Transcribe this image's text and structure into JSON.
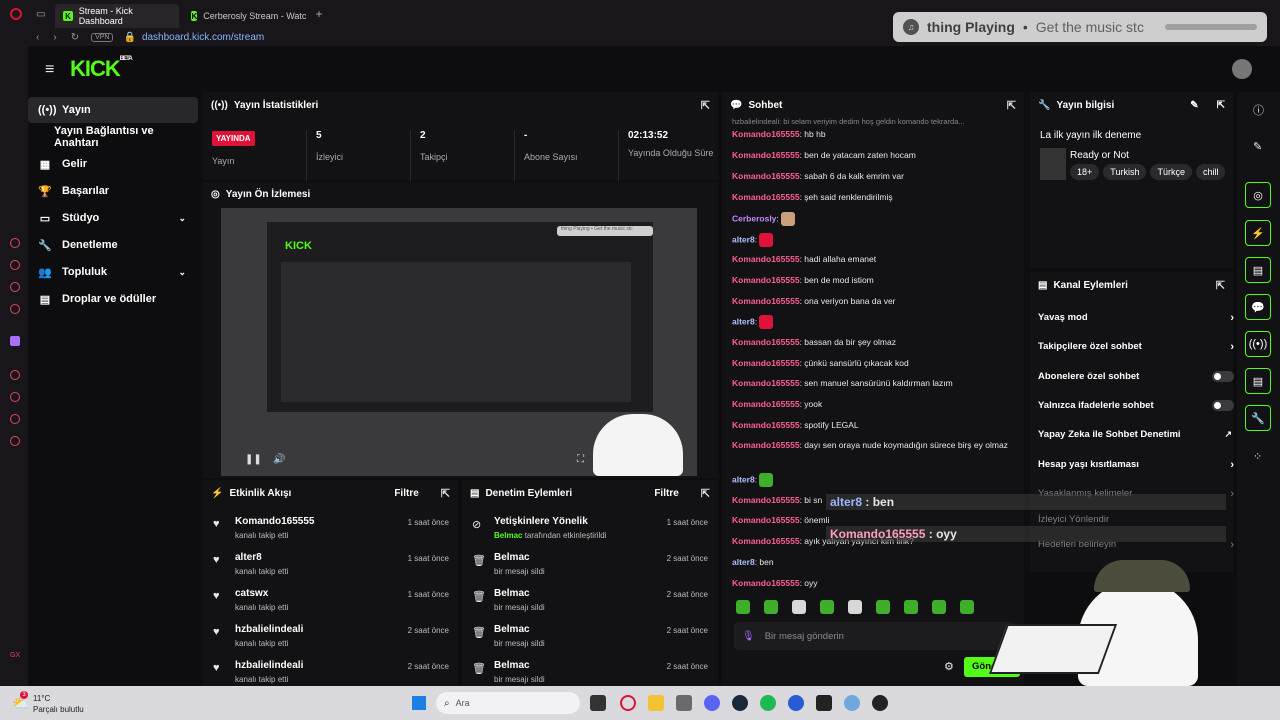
{
  "browser": {
    "tabs": [
      {
        "label": "Stream - Kick Dashboard"
      },
      {
        "label": "Cerberosly Stream - Watc"
      }
    ],
    "vpn": "VPN",
    "url": "dashboard.kick.com/stream"
  },
  "media": {
    "title": "thing Playing",
    "sep": "•",
    "subtitle": "Get the music stc"
  },
  "brand": {
    "logo": "KICK",
    "beta": "BETA"
  },
  "sidebar": {
    "items": [
      {
        "label": "Yayın",
        "icon": "broadcast-icon"
      },
      {
        "label": "Yayın Bağlantısı ve Anahtarı"
      },
      {
        "label": "Gelir",
        "icon": "revenue-icon"
      },
      {
        "label": "Başarılar",
        "icon": "trophy-icon"
      },
      {
        "label": "Stüdyo",
        "icon": "studio-icon"
      },
      {
        "label": "Denetleme",
        "icon": "wrench-icon"
      },
      {
        "label": "Topluluk",
        "icon": "community-icon"
      },
      {
        "label": "Droplar ve ödüller",
        "icon": "drops-icon"
      }
    ]
  },
  "stats": {
    "title": "Yayın İstatistikleri",
    "live_badge": "YAYINDA",
    "live_label": "Yayın",
    "viewers_value": "5",
    "viewers_label": "İzleyici",
    "followers_value": "2",
    "followers_label": "Takipçi",
    "subs_value": "-",
    "subs_label": "Abone Sayısı",
    "uptime_value": "02:13:52",
    "uptime_label": "Yayında Olduğu Süre"
  },
  "preview": {
    "title": "Yayın Ön İzlemesi",
    "inner_pill": "thing Playing • Get the music stc"
  },
  "activity": {
    "title": "Etkinlik Akışı",
    "filter": "Filtre",
    "rows": [
      {
        "name": "Komando165555",
        "sub": "kanalı takip etti",
        "time": "1 saat önce"
      },
      {
        "name": "alter8",
        "sub": "kanalı takip etti",
        "time": "1 saat önce"
      },
      {
        "name": "catswx",
        "sub": "kanalı takip etti",
        "time": "1 saat önce"
      },
      {
        "name": "hzbalielindeali",
        "sub": "kanalı takip etti",
        "time": "2 saat önce"
      },
      {
        "name": "hzbalielindeali",
        "sub": "kanalı takip etti",
        "time": "2 saat önce"
      }
    ]
  },
  "moderation": {
    "title": "Denetim Eylemleri",
    "filter": "Filtre",
    "rows": [
      {
        "name": "Yetişkinlere Yönelik",
        "by": "Belmac",
        "sub": "tarafından etkinleştirildi",
        "time": "1 saat önce"
      },
      {
        "name": "Belmac",
        "sub": "bir mesajı sildi",
        "time": "2 saat önce"
      },
      {
        "name": "Belmac",
        "sub": "bir mesajı sildi",
        "time": "2 saat önce"
      },
      {
        "name": "Belmac",
        "sub": "bir mesajı sildi",
        "time": "2 saat önce"
      },
      {
        "name": "Belmac",
        "sub": "bir mesajı sildi",
        "time": "2 saat önce"
      }
    ]
  },
  "chat": {
    "title": "Sohbet",
    "reply_preview": "hzbalielindeali: bi selam veriyim dedim hoş geldin komando tekrarda...",
    "messages": [
      {
        "user": "Komando165555",
        "text": "hb hb"
      },
      {
        "user": "Komando165555",
        "text": "ben de yatacam zaten hocam"
      },
      {
        "user": "Komando165555",
        "text": "sabah 6 da kalk emrim var"
      },
      {
        "user": "Komando165555",
        "text": "şeh said renklendirilmiş"
      },
      {
        "user": "Cerberosly",
        "text": ""
      },
      {
        "user": "alter8",
        "text": ""
      },
      {
        "user": "Komando165555",
        "text": "hadi allaha emanet"
      },
      {
        "user": "Komando165555",
        "text": "ben de mod istiom"
      },
      {
        "user": "Komando165555",
        "text": "ona veriyon bana da ver"
      },
      {
        "user": "alter8",
        "text": ""
      },
      {
        "user": "Komando165555",
        "text": "bassan da bir şey olmaz"
      },
      {
        "user": "Komando165555",
        "text": "çünkü sansürlü çıkacak kod"
      },
      {
        "user": "Komando165555",
        "text": "sen manuel sansürünü kaldırman lazım"
      },
      {
        "user": "Komando165555",
        "text": "yook"
      },
      {
        "user": "Komando165555",
        "text": "spotify LEGAL"
      },
      {
        "user": "Komando165555",
        "text": "dayı sen oraya nude koymadığın sürece birş ey olmaz"
      },
      {
        "user": "alter8",
        "text": ""
      },
      {
        "user": "Komando165555",
        "text": "bi sn"
      },
      {
        "user": "Komando165555",
        "text": "önemli"
      },
      {
        "user": "Komando165555",
        "text": "ayık yalıyan yayıncı kim lirik?"
      },
      {
        "user": "alter8",
        "text": "ben"
      },
      {
        "user": "Komando165555",
        "text": "oyy"
      }
    ],
    "input_placeholder": "Bir mesaj gönderin",
    "send_label": "Gönder"
  },
  "overlay": {
    "msg1_user": "alter8",
    "msg1_text": "ben",
    "msg2_user": "Komando165555",
    "msg2_text": "oyy",
    "sep": ":"
  },
  "channel_info": {
    "title": "Yayın bilgisi",
    "stream_title": "La ilk yayın ilk deneme",
    "category": "Ready or Not",
    "tags": [
      "18+",
      "Turkish",
      "Türkçe",
      "chill"
    ]
  },
  "channel_actions": {
    "title": "Kanal Eylemleri",
    "options": [
      {
        "label": "Yavaş mod",
        "control": "chevron"
      },
      {
        "label": "Takipçilere özel sohbet",
        "control": "chevron"
      },
      {
        "label": "Abonelere özel sohbet",
        "control": "toggle"
      },
      {
        "label": "Yalnızca ifadelerle sohbet",
        "control": "toggle"
      },
      {
        "label": "Yapay Zeka ile Sohbet Denetimi",
        "control": "external"
      },
      {
        "label": "Hesap yaşı kısıtlaması",
        "control": "chevron"
      },
      {
        "label": "Yasaklanmış kelimeler",
        "control": "chevron"
      },
      {
        "label": "İzleyici Yönlendir",
        "control": "none"
      },
      {
        "label": "Hedefleri belirleyin",
        "control": "chevron"
      }
    ]
  },
  "taskbar": {
    "temp": "11°C",
    "weather": "Parçalı bulutlu",
    "search": "Ara",
    "badge": "3"
  },
  "colors": {
    "accent": "#53fc18",
    "live": "#e0123a",
    "chat_user": "#ff5f93"
  }
}
